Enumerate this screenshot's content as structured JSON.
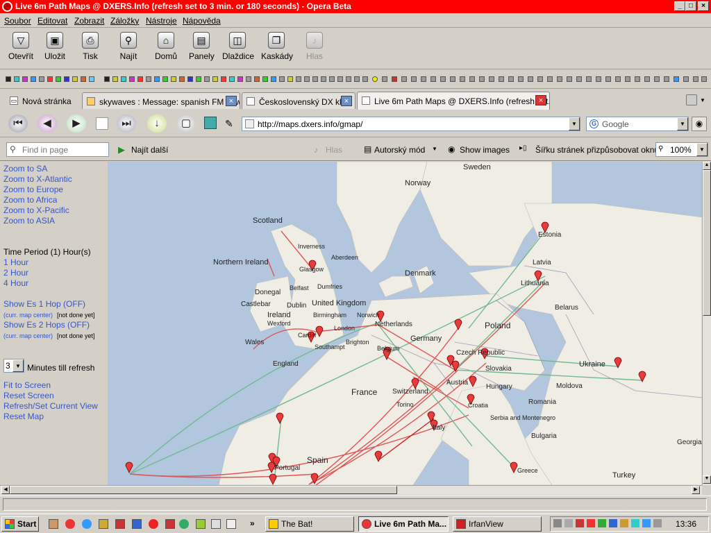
{
  "window": {
    "title": "Live 6m Path Maps @ DXERS.Info (refresh set to 3 min. or 180 seconds) - Opera Beta",
    "minimize": "_",
    "maximize": "□",
    "close": "×"
  },
  "menu": [
    "Soubor",
    "Editovat",
    "Zobrazit",
    "Záložky",
    "Nástroje",
    "Nápověda"
  ],
  "toolbar": [
    {
      "label": "Otevřít",
      "icon": "open-icon"
    },
    {
      "label": "Uložit",
      "icon": "save-icon"
    },
    {
      "label": "Tisk",
      "icon": "print-icon"
    },
    {
      "label": "Najít",
      "icon": "search-icon"
    },
    {
      "label": "Domů",
      "icon": "home-icon"
    },
    {
      "label": "Panely",
      "icon": "panels-icon"
    },
    {
      "label": "Dlaždice",
      "icon": "tile-icon"
    },
    {
      "label": "Kaskády",
      "icon": "cascade-icon"
    },
    {
      "label": "Hlas",
      "icon": "voice-icon",
      "disabled": true
    }
  ],
  "tabs": [
    {
      "label": "Nová stránka"
    },
    {
      "label": "skywaves : Message: spanish FM now"
    },
    {
      "label": "Československý DX klub"
    },
    {
      "label": "Live 6m Path Maps @ DXERS.Info (refresh set..."
    }
  ],
  "tab_close": "×",
  "address": {
    "url": "http://maps.dxers.info/gmap/",
    "search_engine": "Google"
  },
  "findbar": {
    "placeholder": "Find in page",
    "find_next": "Najít další",
    "voice": "Hlas",
    "author_mode": "Autorský mód",
    "show_images": "Show images",
    "fit_width": "Šířku stránek přizpůsobovat oknu",
    "zoom": "100%"
  },
  "sidebar": {
    "zoom_links": [
      "Zoom to SA",
      "Zoom to X-Atlantic",
      "Zoom to Europe",
      "Zoom to Africa",
      "Zoom to X-Pacific",
      "Zoom to ASIA"
    ],
    "time_period": "Time Period (1) Hour(s)",
    "hour_links": [
      "1 Hour",
      "2 Hour",
      "4 Hour"
    ],
    "es1": "Show Es 1 Hop (OFF)",
    "es2": "Show Es 2 Hops (OFF)",
    "curr_center": "(curr. map center)",
    "not_done": "[not done yet]",
    "refresh_value": "3",
    "refresh_label": "Minutes till refresh",
    "bottom_links": [
      "Fit to Screen",
      "Reset Screen",
      "Refresh/Set Current View",
      "Reset Map"
    ]
  },
  "map": {
    "labels": [
      "Sweden",
      "Norway",
      "Scotland",
      "Inverness",
      "Aberdeen",
      "Northern Ireland",
      "Glasgow",
      "Dumfries",
      "Estonia",
      "Latvia",
      "Lithuania",
      "Denmark",
      "Belfast",
      "Donegal",
      "Castlebar",
      "Dublin",
      "Ireland",
      "Wexford",
      "United Kingdom",
      "Birmingham",
      "Norwich",
      "London",
      "Netherlands",
      "Belarus",
      "Poland",
      "Wales",
      "Cardiff",
      "Brighton",
      "Southampt",
      "Germany",
      "Belgium",
      "England",
      "Czech Republic",
      "Slovakia",
      "Ukraine",
      "Austria",
      "Hungary",
      "Moldova",
      "France",
      "Switzerland",
      "Torino",
      "Croatia",
      "Romania",
      "Serbia and Montenegro",
      "Bulgaria",
      "Italy",
      "Spain",
      "Portugal",
      "Greece",
      "Turkey",
      "Georgia"
    ]
  },
  "taskbar": {
    "start": "Start",
    "tasks": [
      "The Bat!",
      "Live 6m Path Ma...",
      "IrfanView"
    ],
    "clock": "13:36"
  }
}
